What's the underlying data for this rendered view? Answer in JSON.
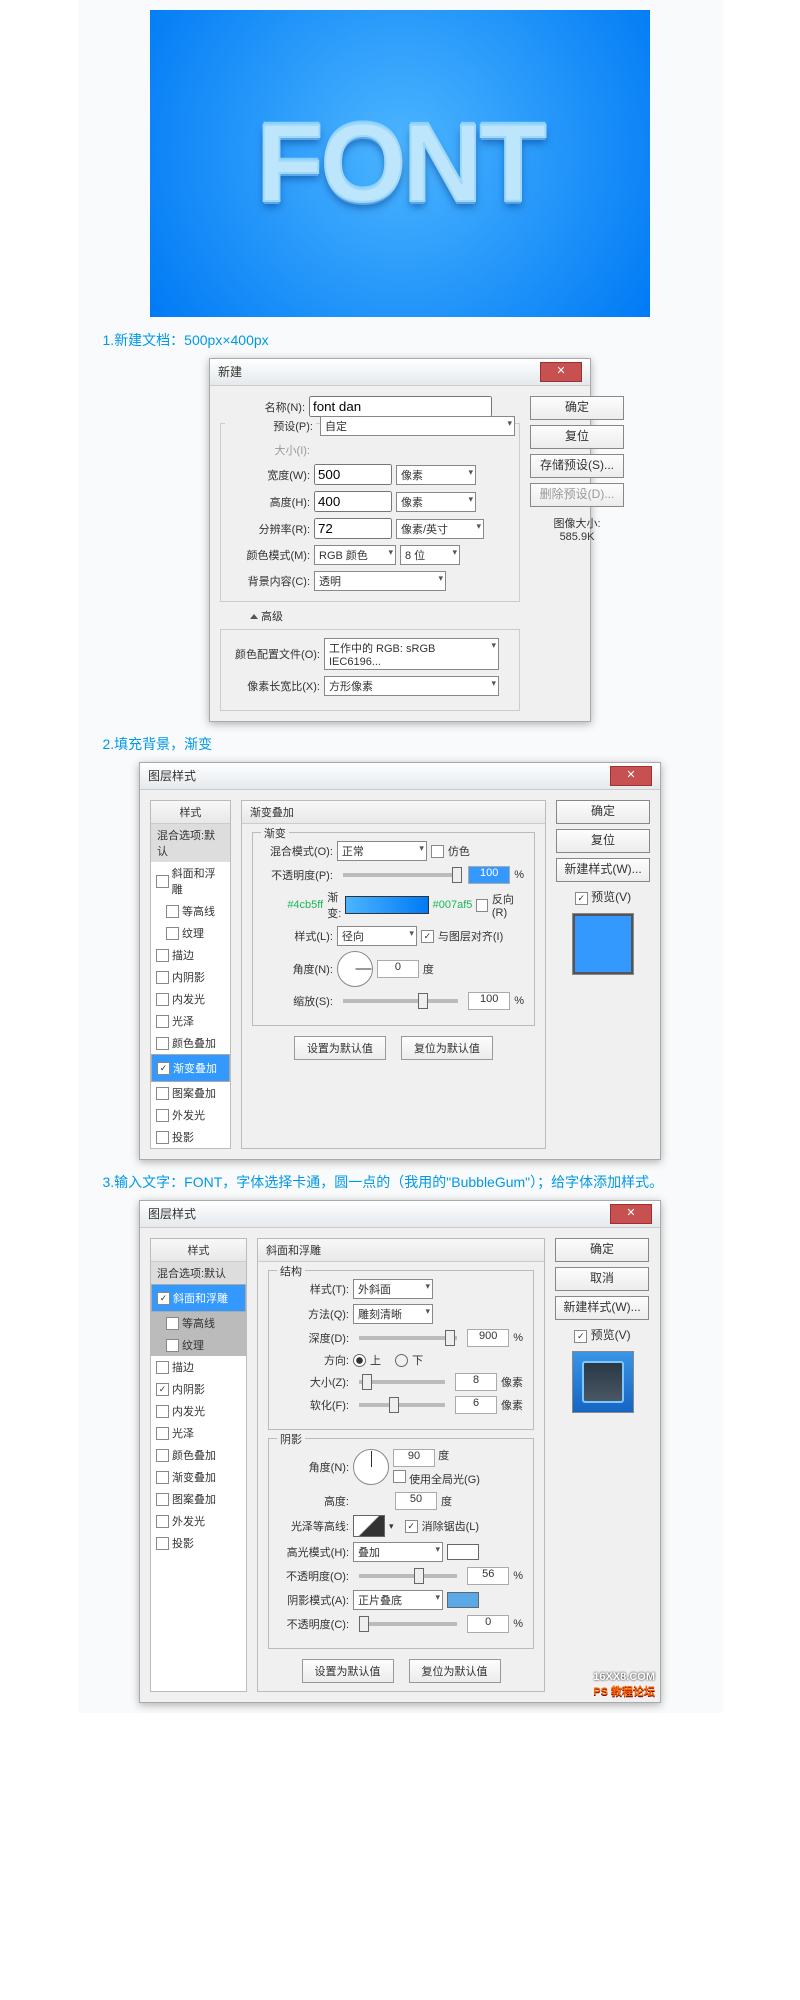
{
  "hero_text": "FONT",
  "step1": "1.新建文档：500px×400px",
  "step2": "2.填充背景，渐变",
  "step3": "3.输入文字：FONT，字体选择卡通，圆一点的（我用的\"BubbleGum\"）；给字体添加样式。",
  "dlg1": {
    "title": "新建",
    "name_lbl": "名称(N):",
    "name_val": "font dan",
    "preset_lbl": "预设(P):",
    "preset_val": "自定",
    "size_lbl": "大小(I):",
    "width_lbl": "宽度(W):",
    "width_val": "500",
    "width_unit": "像素",
    "height_lbl": "高度(H):",
    "height_val": "400",
    "height_unit": "像素",
    "res_lbl": "分辨率(R):",
    "res_val": "72",
    "res_unit": "像素/英寸",
    "mode_lbl": "颜色模式(M):",
    "mode_val": "RGB 颜色",
    "mode_bit": "8 位",
    "bg_lbl": "背景内容(C):",
    "bg_val": "透明",
    "adv": "高级",
    "profile_lbl": "颜色配置文件(O):",
    "profile_val": "工作中的 RGB: sRGB IEC6196...",
    "aspect_lbl": "像素长宽比(X):",
    "aspect_val": "方形像素",
    "imgsize_lbl": "图像大小:",
    "imgsize_val": "585.9K",
    "btn_ok": "确定",
    "btn_cancel": "复位",
    "btn_save": "存储预设(S)...",
    "btn_del": "删除预设(D)..."
  },
  "dlg2": {
    "title": "图层样式",
    "styles_head": "样式",
    "styles_default": "混合选项:默认",
    "s_bevel": "斜面和浮雕",
    "s_contour": "等高线",
    "s_texture": "纹理",
    "s_stroke": "描边",
    "s_innersh": "内阴影",
    "s_innergl": "内发光",
    "s_satin": "光泽",
    "s_color": "颜色叠加",
    "s_grad": "渐变叠加",
    "s_pattern": "图案叠加",
    "s_outer": "外发光",
    "s_drop": "投影",
    "mp_head": "渐变叠加",
    "fs_grad": "渐变",
    "blend_lbl": "混合模式(O):",
    "blend_val": "正常",
    "dither": "仿色",
    "opacity_lbl": "不透明度(P):",
    "opacity_val": "100",
    "pct": "%",
    "col1": "#4cb5ff",
    "col2": "#007af5",
    "grad_lbl": "渐变:",
    "reverse": "反向(R)",
    "style_lbl": "样式(L):",
    "style_val": "径向",
    "align": "与图层对齐(I)",
    "angle_lbl": "角度(N):",
    "angle_val": "0",
    "deg": "度",
    "scale_lbl": "缩放(S):",
    "scale_val": "100",
    "btn_setdef": "设置为默认值",
    "btn_resetdef": "复位为默认值",
    "btn_ok": "确定",
    "btn_cancel": "复位",
    "btn_new": "新建样式(W)...",
    "preview": "预览(V)"
  },
  "dlg3": {
    "title": "图层样式",
    "mp_head": "斜面和浮雕",
    "fs_struct": "结构",
    "style_lbl": "样式(T):",
    "style_val": "外斜面",
    "tech_lbl": "方法(Q):",
    "tech_val": "雕刻清晰",
    "depth_lbl": "深度(D):",
    "depth_val": "900",
    "pct": "%",
    "dir_lbl": "方向:",
    "dir_up": "上",
    "dir_down": "下",
    "size_lbl": "大小(Z):",
    "size_val": "8",
    "px": "像素",
    "soft_lbl": "软化(F):",
    "soft_val": "6",
    "fs_shadow": "阴影",
    "angle_lbl": "角度(N):",
    "angle_val": "90",
    "deg": "度",
    "global": "使用全局光(G)",
    "alt_lbl": "高度:",
    "alt_val": "50",
    "gloss_lbl": "光泽等高线:",
    "anti": "消除锯齿(L)",
    "hl_mode_lbl": "高光模式(H):",
    "hl_mode_val": "叠加",
    "hl_op_lbl": "不透明度(O):",
    "hl_op_val": "56",
    "sh_mode_lbl": "阴影模式(A):",
    "sh_mode_val": "正片叠底",
    "sh_op_lbl": "不透明度(C):",
    "sh_op_val": "0",
    "btn_ok": "确定",
    "btn_cancel": "取消",
    "btn_new": "新建样式(W)...",
    "preview": "预览(V)",
    "btn_setdef": "设置为默认值",
    "btn_resetdef": "复位为默认值"
  },
  "watermark1": "16XX8.COM",
  "watermark2": "PS 教程论坛"
}
